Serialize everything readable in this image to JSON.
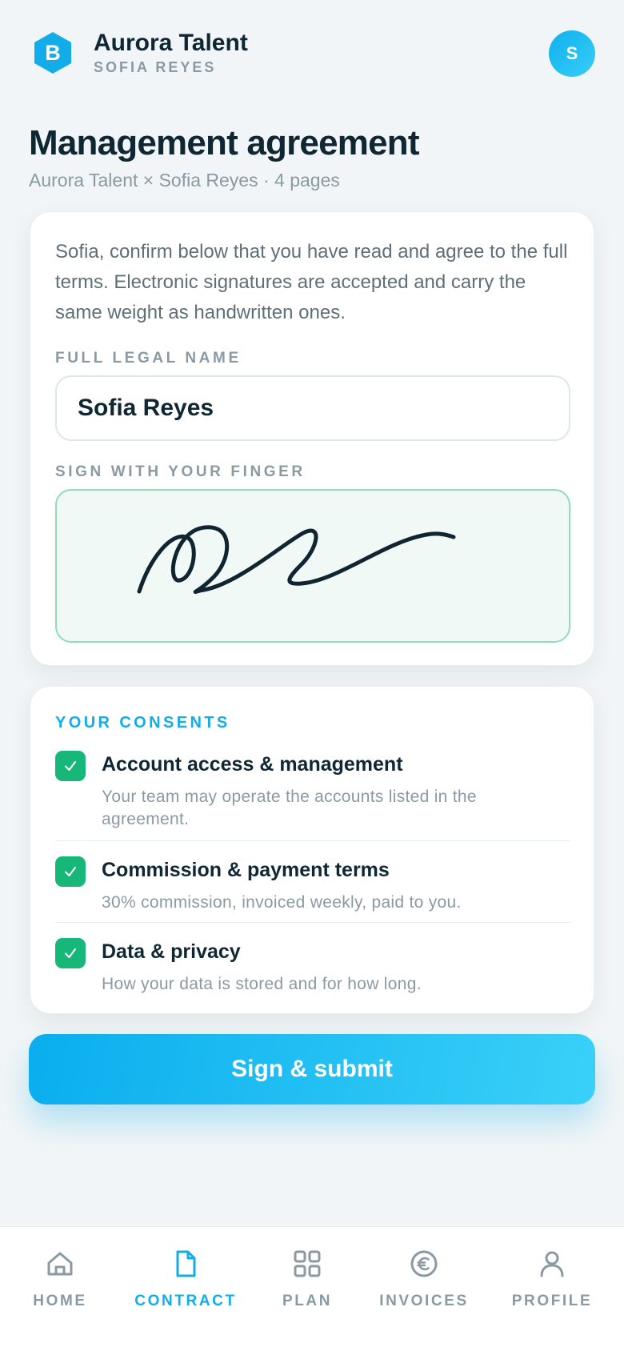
{
  "brand": {
    "name": "Aurora Talent",
    "user": "SOFIA REYES",
    "logo_letter": "B",
    "avatar_initial": "S"
  },
  "page": {
    "title": "Management agreement",
    "subtitle": "Aurora Talent × Sofia Reyes · 4 pages"
  },
  "sign_card": {
    "intro": "Sofia, confirm below that you have read and agree to the full terms. Electronic signatures are accepted and carry the same weight as handwritten ones.",
    "name_label": "FULL LEGAL NAME",
    "name_value": "Sofia Reyes",
    "signature_label": "SIGN WITH YOUR FINGER"
  },
  "consents": {
    "title": "YOUR CONSENTS",
    "items": [
      {
        "title": "Account access & management",
        "description": "Your team may operate the accounts listed in the agreement.",
        "checked": true
      },
      {
        "title": "Commission & payment terms",
        "description": "30% commission, invoiced weekly, paid to you.",
        "checked": true
      },
      {
        "title": "Data & privacy",
        "description": "How your data is stored and for how long.",
        "checked": true
      }
    ]
  },
  "submit_label": "Sign & submit",
  "tabs": [
    {
      "label": "HOME",
      "icon": "home-icon",
      "active": false
    },
    {
      "label": "CONTRACT",
      "icon": "document-icon",
      "active": true
    },
    {
      "label": "PLAN",
      "icon": "grid-icon",
      "active": false
    },
    {
      "label": "INVOICES",
      "icon": "euro-icon",
      "active": false
    },
    {
      "label": "PROFILE",
      "icon": "user-icon",
      "active": false
    }
  ],
  "colors": {
    "accent": "#12ade9",
    "check_green": "#17b77a",
    "text_dark": "#0f2733",
    "text_muted": "#8a9aa3",
    "background": "#f1f5f7"
  }
}
